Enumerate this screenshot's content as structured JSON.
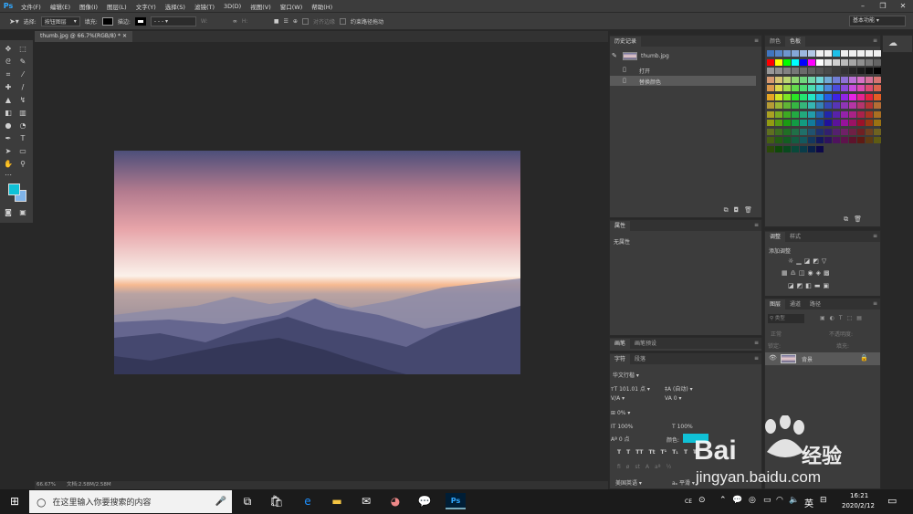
{
  "app": {
    "logo": "Ps"
  },
  "menu": [
    "文件(F)",
    "编辑(E)",
    "图像(I)",
    "图层(L)",
    "文字(Y)",
    "选择(S)",
    "滤镜(T)",
    "3D(D)",
    "视图(V)",
    "窗口(W)",
    "帮助(H)"
  ],
  "options": {
    "select_label": "选择:",
    "select_value": "按钮图层",
    "fill_label": "填充:",
    "stroke_label": "描边:",
    "align_label": "对齐边缘",
    "constrain_label": "约束路径拖动"
  },
  "workspace": "基本功能",
  "document": {
    "tab_title": "thumb.jpg @ 66.7%(RGB/8) *",
    "zoom": "66.67%",
    "doc_size": "文档:2.58M/2.58M"
  },
  "history": {
    "tabs": [
      "历史记录"
    ],
    "snapshot": "thumb.jpg",
    "items": [
      "打开",
      "替换颜色"
    ]
  },
  "color_panel": {
    "tabs": [
      "颜色",
      "色板"
    ]
  },
  "properties": {
    "tabs": [
      "属性"
    ],
    "text": "无属性"
  },
  "adjustments": {
    "tabs": [
      "调整",
      "样式"
    ],
    "title": "添加调整"
  },
  "layers": {
    "tabs": [
      "图层",
      "通道",
      "路径"
    ],
    "kind": "类型",
    "mode": "正常",
    "opacity": "不透明度:",
    "lock": "锁定:",
    "fill": "填充:",
    "layer_name": "背景"
  },
  "brush_panel": {
    "tabs": [
      "画笔",
      "画笔预设"
    ]
  },
  "character": {
    "tabs": [
      "字符",
      "段落"
    ],
    "font": "华文行楷",
    "size": "101.01 点",
    "leading": "(自动)",
    "tracking": "0",
    "scale_pct": "0%",
    "vscale": "100%",
    "hscale": "100%",
    "baseline": "0 点",
    "color_label": "颜色:",
    "lang": "美国英语",
    "aa": "平滑"
  },
  "taskbar": {
    "search_placeholder": "在这里输入你要搜索的内容",
    "time": "16:21",
    "date": "2020/2/12",
    "ime": "英",
    "ime2": "CE"
  },
  "watermark": {
    "brand": "Bai",
    "brand2": "经验",
    "url": "jingyan.baidu.com"
  },
  "colors": {
    "fg": "#10c1d6",
    "bg": "#7fb3e8"
  }
}
